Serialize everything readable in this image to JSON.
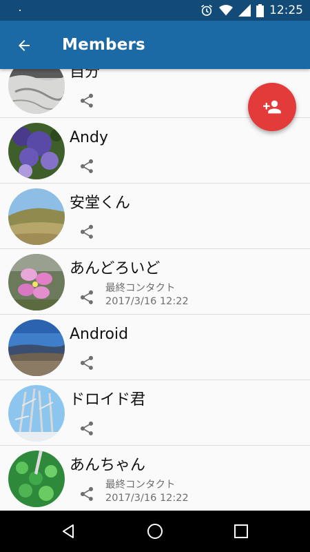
{
  "status_bar": {
    "time": "12:25",
    "icons": [
      "alarm-icon",
      "wifi-icon",
      "signal-icon",
      "battery-icon"
    ]
  },
  "app_bar": {
    "title": "Members",
    "back_icon": "arrow-back-icon"
  },
  "fab": {
    "icon": "person-add-icon",
    "color": "#e33a3a"
  },
  "members": [
    {
      "name": "自分",
      "avatar": "snowy-hill-photo"
    },
    {
      "name": "Andy",
      "avatar": "hydrangea-photo"
    },
    {
      "name": "安堂くん",
      "avatar": "mountain-ridge-photo"
    },
    {
      "name": "あんどろいど",
      "avatar": "pink-flower-photo",
      "contact_label": "最終コンタクト",
      "contact_time": "2017/3/16 12:22"
    },
    {
      "name": "Android",
      "avatar": "mountain-view-photo"
    },
    {
      "name": "ドロイド君",
      "avatar": "snowy-trees-photo"
    },
    {
      "name": "あんちゃん",
      "avatar": "green-moss-photo",
      "contact_label": "最終コンタクト",
      "contact_time": "2017/3/16 12:22"
    }
  ],
  "colors": {
    "status_bar": "#124a78",
    "app_bar": "#1c6aa5",
    "background": "#fafafa",
    "divider": "#dcdcdc"
  },
  "nav_bar": {
    "icons": [
      "back-triangle-icon",
      "home-circle-icon",
      "recents-square-icon"
    ]
  }
}
